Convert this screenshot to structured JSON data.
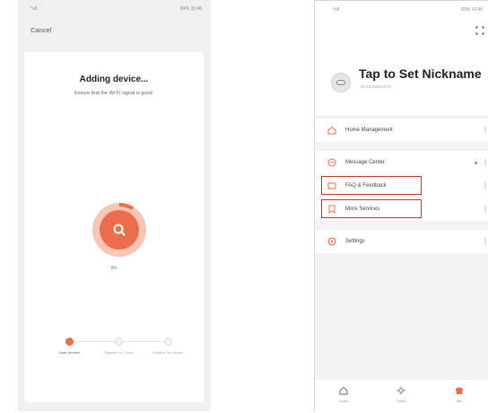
{
  "left_screen": {
    "status_left": "*ull",
    "status_right": "84% 10:46",
    "cancel_label": "Cancel",
    "title": "Adding device...",
    "subtitle": "Ensure that the Wi-Fi signal is good.",
    "progress_text": "9%",
    "progress_fraction": 0.09,
    "steps": [
      {
        "label": "Scan devices",
        "active": true
      },
      {
        "label": "Register on Cloud",
        "active": false
      },
      {
        "label": "Initialize the device",
        "active": false
      }
    ],
    "accent_color": "#ec6d4c"
  },
  "right_screen": {
    "status_left": "*ull",
    "status_right": "83% 10:46",
    "nickname": "Tap to Set Nickname",
    "user_id": "86-18158852575",
    "menu": {
      "home_management": "Home Management",
      "message_center": "Message Center",
      "faq_feedback": "FAQ & Feedback",
      "more_services": "More Services",
      "settings": "Settings"
    },
    "tabs": [
      {
        "label": "Home",
        "icon": "home-icon"
      },
      {
        "label": "Smart",
        "icon": "sun-icon"
      },
      {
        "label": "Me",
        "icon": "me-icon"
      }
    ],
    "highlight_color": "#c9302c"
  }
}
